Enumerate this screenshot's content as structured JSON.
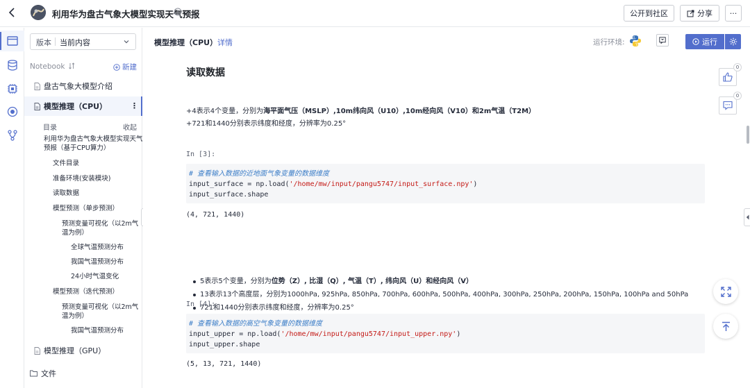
{
  "header": {
    "title": "利用华为盘古气象大模型实现天气预报",
    "publish_label": "公开到社区",
    "share_label": "分享",
    "more_label": "···"
  },
  "sidebar": {
    "version_label": "版本",
    "version_value": "当前内容",
    "notebook_label": "Notebook",
    "new_label": "新建",
    "files": [
      {
        "label": "盘古气象大模型介绍"
      },
      {
        "label": "模型推理（CPU）"
      },
      {
        "label": "模型推理（GPU）"
      }
    ],
    "toc_label": "目录",
    "toc_collapse": "收起",
    "toc": [
      "利用华为盘古气象大模型实现天气",
      "预报（基于CPU算力）",
      "文件目录",
      "准备环境(安装模块)",
      "读取数据",
      "模型预测（单步预测）",
      "预测变量可视化（以2m气",
      "温为例）",
      "全球气温预测分布",
      "我国气温预测分布",
      "24小时气温变化",
      "模型预测（迭代预测）",
      "预测变量可视化（以2m气",
      "温为例）",
      "我国气温预测分布"
    ],
    "files_label": "文件",
    "kebab": "⋮"
  },
  "toolbar": {
    "notebook_title": "模型推理（CPU）",
    "detail_link": "详情",
    "env_label": "运行环境:",
    "run_label": "运行"
  },
  "notebook": {
    "heading": "读取数据",
    "para1_prefix": "+4表示4个变量，分别为",
    "para1_bold": "海平面气压（MSLP）,10m纬向风（U10）,10m经向风（V10）和2m气温（T2M）",
    "para2": "+721和1440分别表示纬度和经度，分辨率为0.25°",
    "cell3": {
      "prompt": "In [3]:",
      "comment": "# 查看输入数据的近地面气象变量的数据维度",
      "line1_pre": "input_surface = np.load(",
      "line1_str": "'/home/mw/input/pangu5747/input_surface.npy'",
      "line1_post": ")",
      "line2": "input_surface.shape",
      "output": "(4, 721, 1440)"
    },
    "bullets": {
      "b1_prefix": "5表示5个变量，分别为",
      "b1_bold": "位势（Z）, 比湿（Q）, 气温（T）, 纬向风（U）和经向风（V）",
      "b2": "13表示13个高度层，分别为1000hPa, 925hPa, 850hPa, 700hPa, 600hPa, 500hPa, 400hPa, 300hPa, 250hPa, 200hPa, 150hPa, 100hPa and 50hPa",
      "b3": "721和1440分别表示纬度和经度，分辨率为0.25°"
    },
    "cell4": {
      "prompt": "In [4]:",
      "comment": "# 查看输入数据的高空气象变量的数据维度",
      "line1_pre": "input_upper = np.load(",
      "line1_str": "'/home/mw/input/pangu5747/input_upper.npy'",
      "line1_post": ")",
      "line2": "input_upper.shape",
      "output": "(5, 13, 721, 1440)"
    }
  },
  "floating": {
    "like_count": "0",
    "comment_count": "0"
  },
  "colors": {
    "accent": "#526ecc",
    "comment": "#3e7fc8",
    "string": "#c41a16"
  }
}
